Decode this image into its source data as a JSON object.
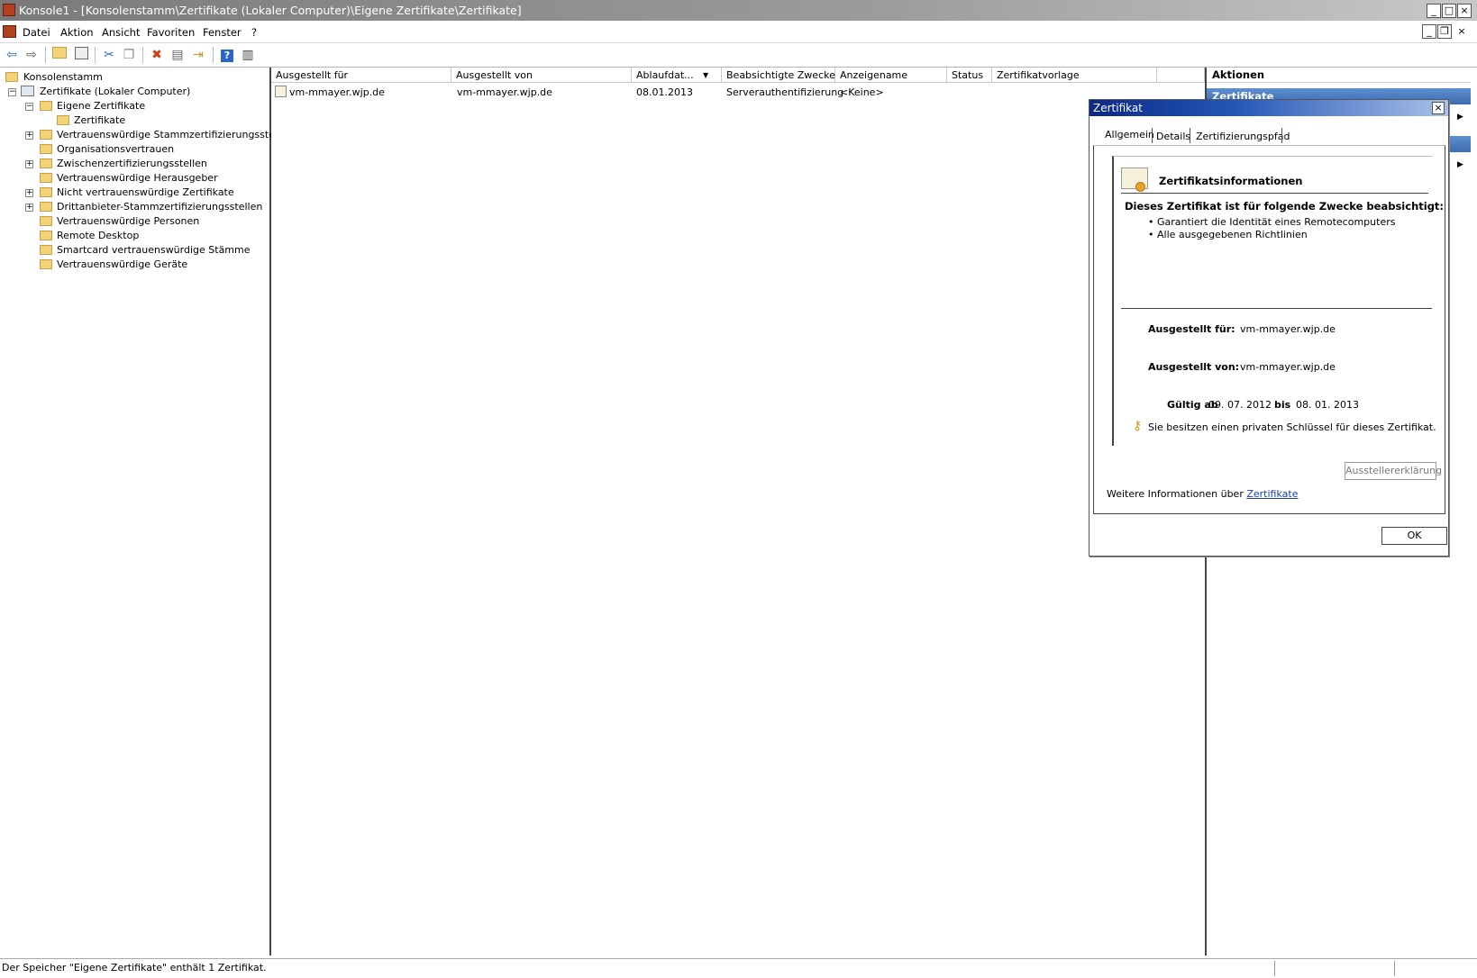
{
  "window": {
    "title": "Konsole1 - [Konsolenstamm\\Zertifikate (Lokaler Computer)\\Eigene Zertifikate\\Zertifikate]",
    "minimize": "_",
    "maximize": "□",
    "close": "×",
    "inner_minimize": "_",
    "inner_restore": "❐",
    "inner_close": "×"
  },
  "menu": [
    "Datei",
    "Aktion",
    "Ansicht",
    "Favoriten",
    "Fenster",
    "?"
  ],
  "toolbar_icons": [
    "back-icon",
    "forward-icon",
    "up-folder-icon",
    "show-hide-tree-icon",
    "cut-icon",
    "copy-icon",
    "delete-icon",
    "properties-icon",
    "export-icon",
    "help-icon",
    "show-hide-action-pane-icon"
  ],
  "tree": {
    "root": "Konsolenstamm",
    "computer": "Zertifikate (Lokaler Computer)",
    "items": [
      {
        "label": "Eigene Zertifikate",
        "expander": "−"
      },
      {
        "label": "Zertifikate",
        "expander": ""
      },
      {
        "label": "Vertrauenswürdige Stammzertifizierungsstellen",
        "expander": "+"
      },
      {
        "label": "Organisationsvertrauen",
        "expander": ""
      },
      {
        "label": "Zwischenzertifizierungsstellen",
        "expander": "+"
      },
      {
        "label": "Vertrauenswürdige Herausgeber",
        "expander": ""
      },
      {
        "label": "Nicht vertrauenswürdige Zertifikate",
        "expander": "+"
      },
      {
        "label": "Drittanbieter-Stammzertifizierungsstellen",
        "expander": "+"
      },
      {
        "label": "Vertrauenswürdige Personen",
        "expander": ""
      },
      {
        "label": "Remote Desktop",
        "expander": ""
      },
      {
        "label": "Smartcard vertrauenswürdige Stämme",
        "expander": ""
      },
      {
        "label": "Vertrauenswürdige Geräte",
        "expander": ""
      }
    ]
  },
  "list": {
    "columns": [
      "Ausgestellt für",
      "Ausgestellt von",
      "Ablaufdat...",
      "Beabsichtigte Zwecke",
      "Anzeigename",
      "Status",
      "Zertifikatvorlage"
    ],
    "sort_arrow": "▼",
    "rows": [
      [
        "vm-mmayer.wjp.de",
        "vm-mmayer.wjp.de",
        "08.01.2013",
        "Serverauthentifizierung",
        "<Keine>",
        "",
        ""
      ]
    ]
  },
  "actions": {
    "header": "Aktionen",
    "section1": "Zertifikate",
    "arrow": "▶"
  },
  "dialog": {
    "title": "Zertifikat",
    "close": "×",
    "tabs": [
      "Allgemein",
      "Details",
      "Zertifizierungspfad"
    ],
    "info_title": "Zertifikatsinformationen",
    "purpose_heading": "Dieses Zertifikat ist für folgende Zwecke beabsichtigt:",
    "purposes": [
      "• Garantiert die Identität eines Remotecomputers",
      "• Alle ausgegebenen Richtlinien"
    ],
    "issued_to_label": "Ausgestellt für:",
    "issued_to_value": "vm-mmayer.wjp.de",
    "issued_by_label": "Ausgestellt von:",
    "issued_by_value": "vm-mmayer.wjp.de",
    "valid_from_label": "Gültig ab",
    "valid_from_value": "09. 07. 2012",
    "valid_to_label": "bis",
    "valid_to_value": "08. 01. 2013",
    "key_note": "Sie besitzen einen privaten Schlüssel für dieses Zertifikat.",
    "issuer_statement_button": "Ausstellererklärung",
    "more_info_prefix": "Weitere Informationen über",
    "more_info_link": "Zertifikate",
    "ok_button": "OK"
  },
  "status": {
    "text": "Der Speicher \"Eigene Zertifikate\" enthält 1 Zertifikat."
  }
}
